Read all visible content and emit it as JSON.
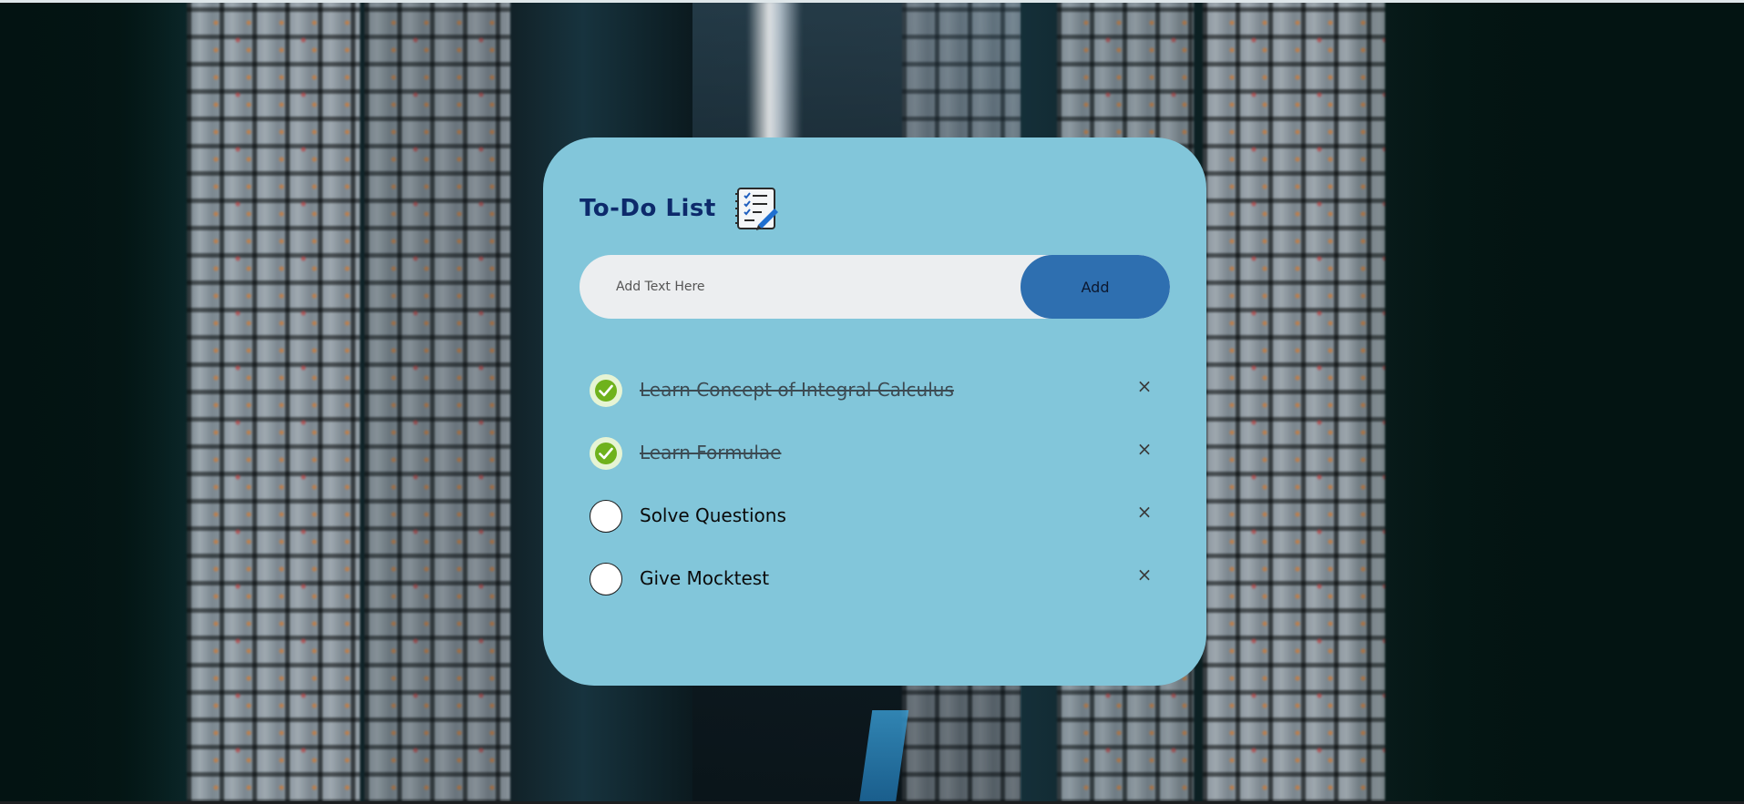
{
  "app": {
    "title": "To-Do List",
    "title_icon": "checklist-notepad-icon"
  },
  "input": {
    "placeholder": "Add Text Here",
    "value": "",
    "add_label": "Add"
  },
  "tasks": [
    {
      "text": "Learn Concept of Integral Calculus",
      "done": true,
      "remove_label": "×"
    },
    {
      "text": "Learn Formulae",
      "done": true,
      "remove_label": "×"
    },
    {
      "text": "Solve Questions",
      "done": false,
      "remove_label": "×"
    },
    {
      "text": "Give Mocktest",
      "done": false,
      "remove_label": "×"
    }
  ],
  "colors": {
    "card": "#82c6da",
    "title": "#0d2a6b",
    "input_bg": "#eceef0",
    "add_button": "#2e6fb0",
    "checked": "#6fb21c"
  }
}
